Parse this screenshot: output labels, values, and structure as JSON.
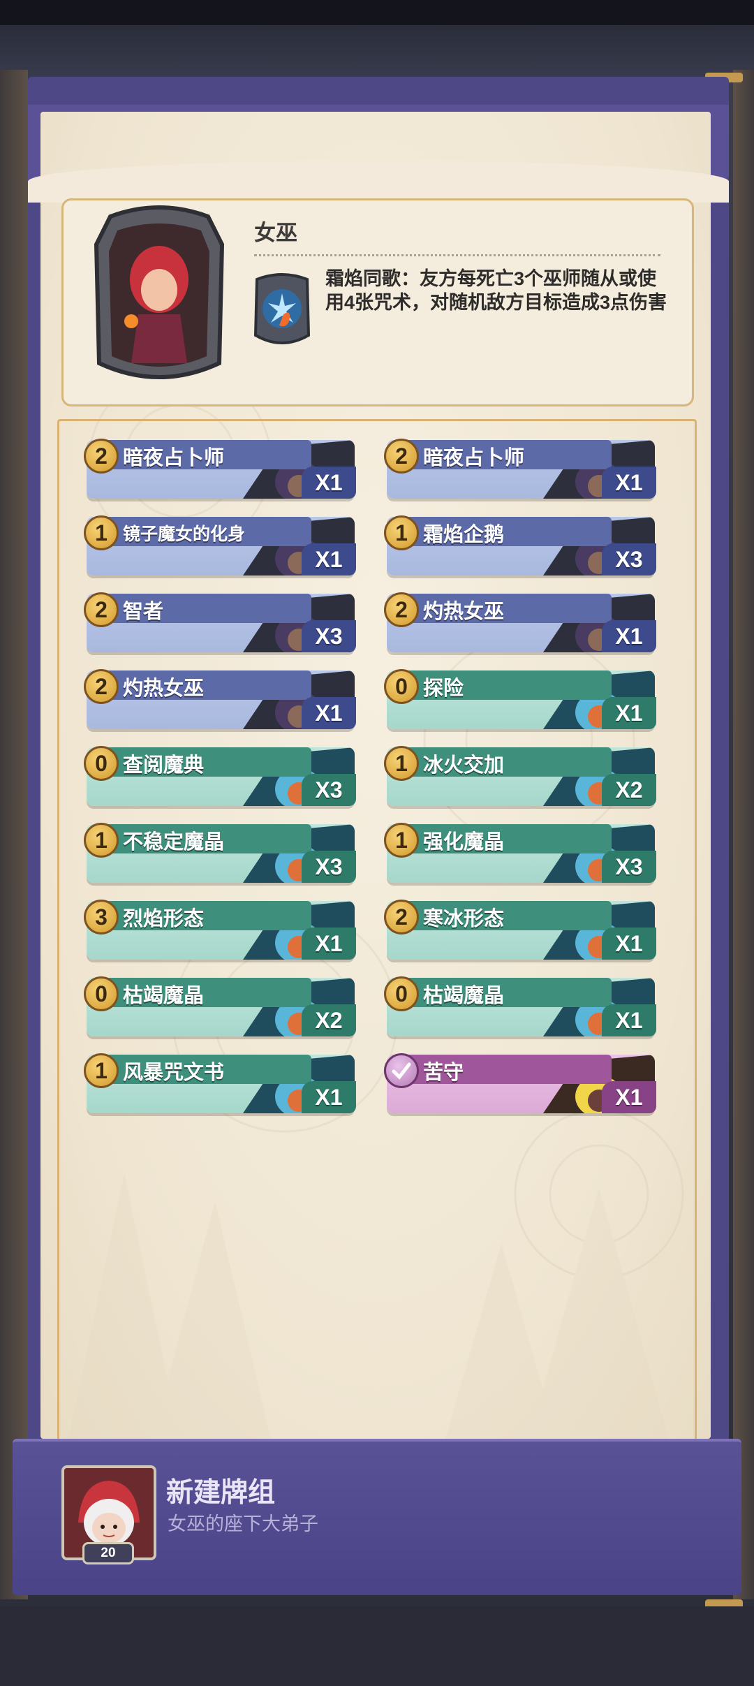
{
  "hero": {
    "name": "女巫",
    "skill_text": "霜焰同歌：友方每死亡3个巫师随从或使用4张咒术，对随机敌方目标造成3点伤害"
  },
  "cards": [
    {
      "cost": "2",
      "name": "暗夜占卜师",
      "count": "X1",
      "style": "blue"
    },
    {
      "cost": "2",
      "name": "暗夜占卜师",
      "count": "X1",
      "style": "blue"
    },
    {
      "cost": "1",
      "name": "镜子魔女的化身",
      "count": "X1",
      "style": "blue"
    },
    {
      "cost": "1",
      "name": "霜焰企鹅",
      "count": "X3",
      "style": "blue"
    },
    {
      "cost": "2",
      "name": "智者",
      "count": "X3",
      "style": "blue"
    },
    {
      "cost": "2",
      "name": "灼热女巫",
      "count": "X1",
      "style": "blue"
    },
    {
      "cost": "2",
      "name": "灼热女巫",
      "count": "X1",
      "style": "blue"
    },
    {
      "cost": "0",
      "name": "探险",
      "count": "X1",
      "style": "teal"
    },
    {
      "cost": "0",
      "name": "查阅魔典",
      "count": "X3",
      "style": "teal"
    },
    {
      "cost": "1",
      "name": "冰火交加",
      "count": "X2",
      "style": "teal"
    },
    {
      "cost": "1",
      "name": "不稳定魔晶",
      "count": "X3",
      "style": "teal"
    },
    {
      "cost": "1",
      "name": "强化魔晶",
      "count": "X3",
      "style": "teal"
    },
    {
      "cost": "3",
      "name": "烈焰形态",
      "count": "X1",
      "style": "teal"
    },
    {
      "cost": "2",
      "name": "寒冰形态",
      "count": "X1",
      "style": "teal"
    },
    {
      "cost": "0",
      "name": "枯竭魔晶",
      "count": "X2",
      "style": "teal"
    },
    {
      "cost": "0",
      "name": "枯竭魔晶",
      "count": "X1",
      "style": "teal"
    },
    {
      "cost": "1",
      "name": "风暴咒文书",
      "count": "X1",
      "style": "teal"
    },
    {
      "cost": "",
      "name": "苦守",
      "count": "X1",
      "style": "pink"
    }
  ],
  "deck": {
    "title": "新建牌组",
    "subtitle": "女巫的座下大弟子",
    "card_count": "20"
  }
}
